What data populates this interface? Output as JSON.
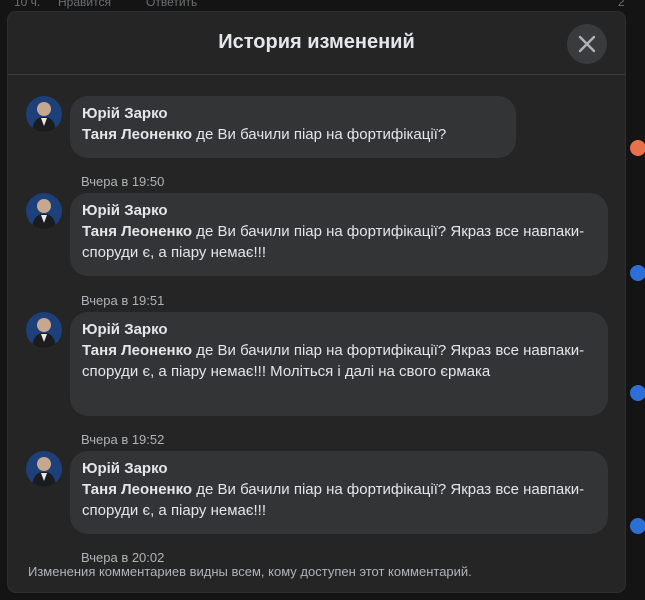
{
  "background": {
    "time_label": "10 ч.",
    "like_label": "Нравится",
    "reply_label": "Ответить",
    "count": "2"
  },
  "modal": {
    "title": "История изменений",
    "close_icon": "close-icon",
    "footer": "Изменения комментариев видны всем, кому доступен этот комментарий."
  },
  "entries": [
    {
      "author": "Юрій Зарко",
      "mention": "Таня Леоненко",
      "text": "де Ви бачили піар на фортифікації?",
      "timestamp": "Вчера в 19:50"
    },
    {
      "author": "Юрій Зарко",
      "mention": "Таня Леоненко",
      "text": "де Ви бачили піар на фортифікації? Якраз все навпаки- споруди є, а піару немає!!!",
      "timestamp": "Вчера в 19:51"
    },
    {
      "author": "Юрій Зарко",
      "mention": "Таня Леоненко",
      "text": "де Ви бачили піар на фортифікації? Якраз все навпаки- споруди є, а піару немає!!! Моліться і далі на свого єрмака",
      "timestamp": "Вчера в 19:52"
    },
    {
      "author": "Юрій Зарко",
      "mention": "Таня Леоненко",
      "text": "де Ви бачили піар на фортифікації? Якраз все навпаки- споруди є, а піару немає!!!",
      "timestamp": "Вчера в 20:02"
    }
  ],
  "colors": {
    "modal_bg": "#252526",
    "bubble_bg": "#333435",
    "text": "#e4e6eb",
    "muted": "#b0b3b8"
  }
}
